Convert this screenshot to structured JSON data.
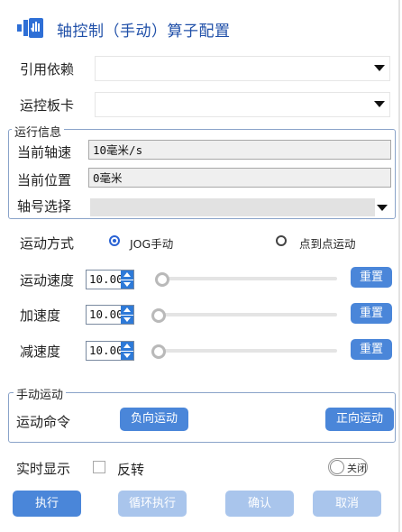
{
  "header": {
    "title": "轴控制（手动）算子配置",
    "icon": "axis-control-icon"
  },
  "fields": {
    "ref_label": "引用依赖",
    "ref_value": "",
    "card_label": "运控板卡",
    "card_value": ""
  },
  "run_info": {
    "title": "运行信息",
    "speed_label": "当前轴速",
    "speed_value": "10毫米/s",
    "pos_label": "当前位置",
    "pos_value": "0毫米",
    "axis_label": "轴号选择",
    "axis_value": ""
  },
  "motion": {
    "mode_label": "运动方式",
    "mode_options": [
      "JOG手动",
      "点到点运动"
    ],
    "mode_selected": "JOG手动",
    "rows": [
      {
        "label": "运动速度",
        "value": "10.00",
        "slider": 0,
        "reset": "重置"
      },
      {
        "label": "加速度",
        "value": "10.00",
        "slider": 0,
        "reset": "重置"
      },
      {
        "label": "减速度",
        "value": "10.00",
        "slider": 0,
        "reset": "重置"
      }
    ]
  },
  "manual": {
    "title": "手动运动",
    "cmd_label": "运动命令",
    "neg_button": "负向运动",
    "pos_button": "正向运动"
  },
  "footer": {
    "realtime_label": "实时显示",
    "reverse_label": "反转",
    "reverse_checked": false,
    "toggle_label": "关闭",
    "toggle_on": false,
    "buttons": [
      "执行",
      "循环执行",
      "确认",
      "取消"
    ]
  },
  "colors": {
    "accent": "#4a86d9",
    "accent_dim": "#a9c5ec",
    "title": "#1f4fa8"
  }
}
